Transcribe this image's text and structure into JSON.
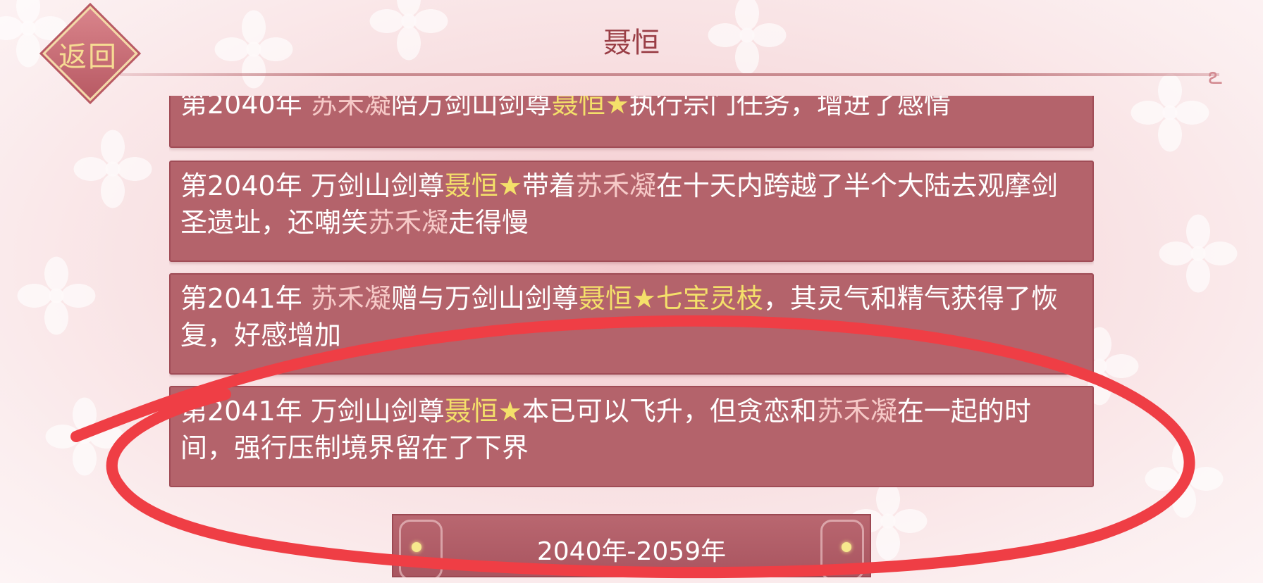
{
  "header": {
    "back_label": "返回",
    "title": "聂恒"
  },
  "events": [
    {
      "segments": [
        {
          "t": "第2040年 ",
          "c": "plain"
        },
        {
          "t": "苏禾凝",
          "c": "name"
        },
        {
          "t": "陪万剑山剑尊",
          "c": "plain"
        },
        {
          "t": "聂恒★",
          "c": "hl"
        },
        {
          "t": "执行宗门任务，增进了感情",
          "c": "plain"
        }
      ]
    },
    {
      "segments": [
        {
          "t": "第2040年 万剑山剑尊",
          "c": "plain"
        },
        {
          "t": "聂恒★",
          "c": "hl"
        },
        {
          "t": "带着",
          "c": "plain"
        },
        {
          "t": "苏禾凝",
          "c": "name"
        },
        {
          "t": "在十天内跨越了半个大陆去观摩剑圣遗址，还嘲笑",
          "c": "plain"
        },
        {
          "t": "苏禾凝",
          "c": "name"
        },
        {
          "t": "走得慢",
          "c": "plain"
        }
      ]
    },
    {
      "segments": [
        {
          "t": "第2041年 ",
          "c": "plain"
        },
        {
          "t": "苏禾凝",
          "c": "name"
        },
        {
          "t": "赠与万剑山剑尊",
          "c": "plain"
        },
        {
          "t": "聂恒★",
          "c": "hl"
        },
        {
          "t": "七宝灵枝",
          "c": "hl"
        },
        {
          "t": "，其灵气和精气获得了恢复，好感增加",
          "c": "plain"
        }
      ]
    },
    {
      "segments": [
        {
          "t": "第2041年 万剑山剑尊",
          "c": "plain"
        },
        {
          "t": "聂恒★",
          "c": "hl"
        },
        {
          "t": "本已可以飞升，但贪恋和",
          "c": "plain"
        },
        {
          "t": "苏禾凝",
          "c": "name"
        },
        {
          "t": "在一起的时间，强行压制境界留在了下界",
          "c": "plain"
        }
      ]
    }
  ],
  "range_button": {
    "label": "2040年-2059年"
  },
  "colors": {
    "card_bg": "#b4636b",
    "name_color": "#f6c9c7",
    "highlight_color": "#f4e06a",
    "title_color": "#9a3e46",
    "annotation_stroke": "#ef3e45"
  },
  "icons": [
    "diamond-back-badge",
    "star-icon",
    "flower-petal-decor",
    "scroll-ornament"
  ]
}
